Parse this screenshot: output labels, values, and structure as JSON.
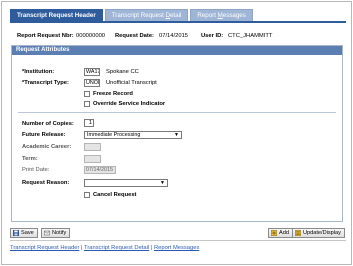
{
  "tabs": [
    {
      "label": "Transcript Request Header",
      "active": true
    },
    {
      "label_pre": "Transcript Request ",
      "label_ul": "D",
      "label_post": "etail",
      "active": false
    },
    {
      "label_pre": "Report ",
      "label_ul": "M",
      "label_post": "essages",
      "active": false
    }
  ],
  "header": {
    "report_nbr_label": "Report Request Nbr:",
    "report_nbr_value": "000000000",
    "request_date_label": "Request Date:",
    "request_date_value": "07/14/2015",
    "user_id_label": "User ID:",
    "user_id_value": "CTC_JHAMMITT"
  },
  "group": {
    "title": "Request Attributes",
    "institution_label": "*Institution:",
    "institution_value": "WA171",
    "institution_desc": "Spokane CC",
    "transcript_type_label": "*Transcript Type:",
    "transcript_type_value": "UNOFF",
    "transcript_type_desc": "Unofficial Transcript",
    "freeze_record_label": "Freeze Record",
    "override_service_label": "Override Service Indicator",
    "copies_label": "Number of Copies:",
    "copies_value": "1",
    "future_release_label": "Future Release:",
    "future_release_value": "Immediate Processing",
    "academic_career_label": "Academic Career:",
    "academic_career_value": "",
    "term_label": "Term:",
    "term_value": "",
    "print_date_label": "Print Date:",
    "print_date_value": "07/14/2015",
    "request_reason_label": "Request Reason:",
    "request_reason_value": "",
    "cancel_request_label": "Cancel Request"
  },
  "buttons": {
    "save": "Save",
    "notify": "Notify",
    "add": "Add",
    "update_display": "Update/Display"
  },
  "footer_links": {
    "link1": "Transcript Request Header",
    "sep1": " | ",
    "link2": "Transcript Request Detail",
    "sep2": " | ",
    "link3": "Report Messages"
  },
  "colors": {
    "tab_active": "#2f5c9c",
    "tab_inactive": "#9fb5d6",
    "group_header": "#5c7fb3",
    "link": "#2a5db0"
  }
}
